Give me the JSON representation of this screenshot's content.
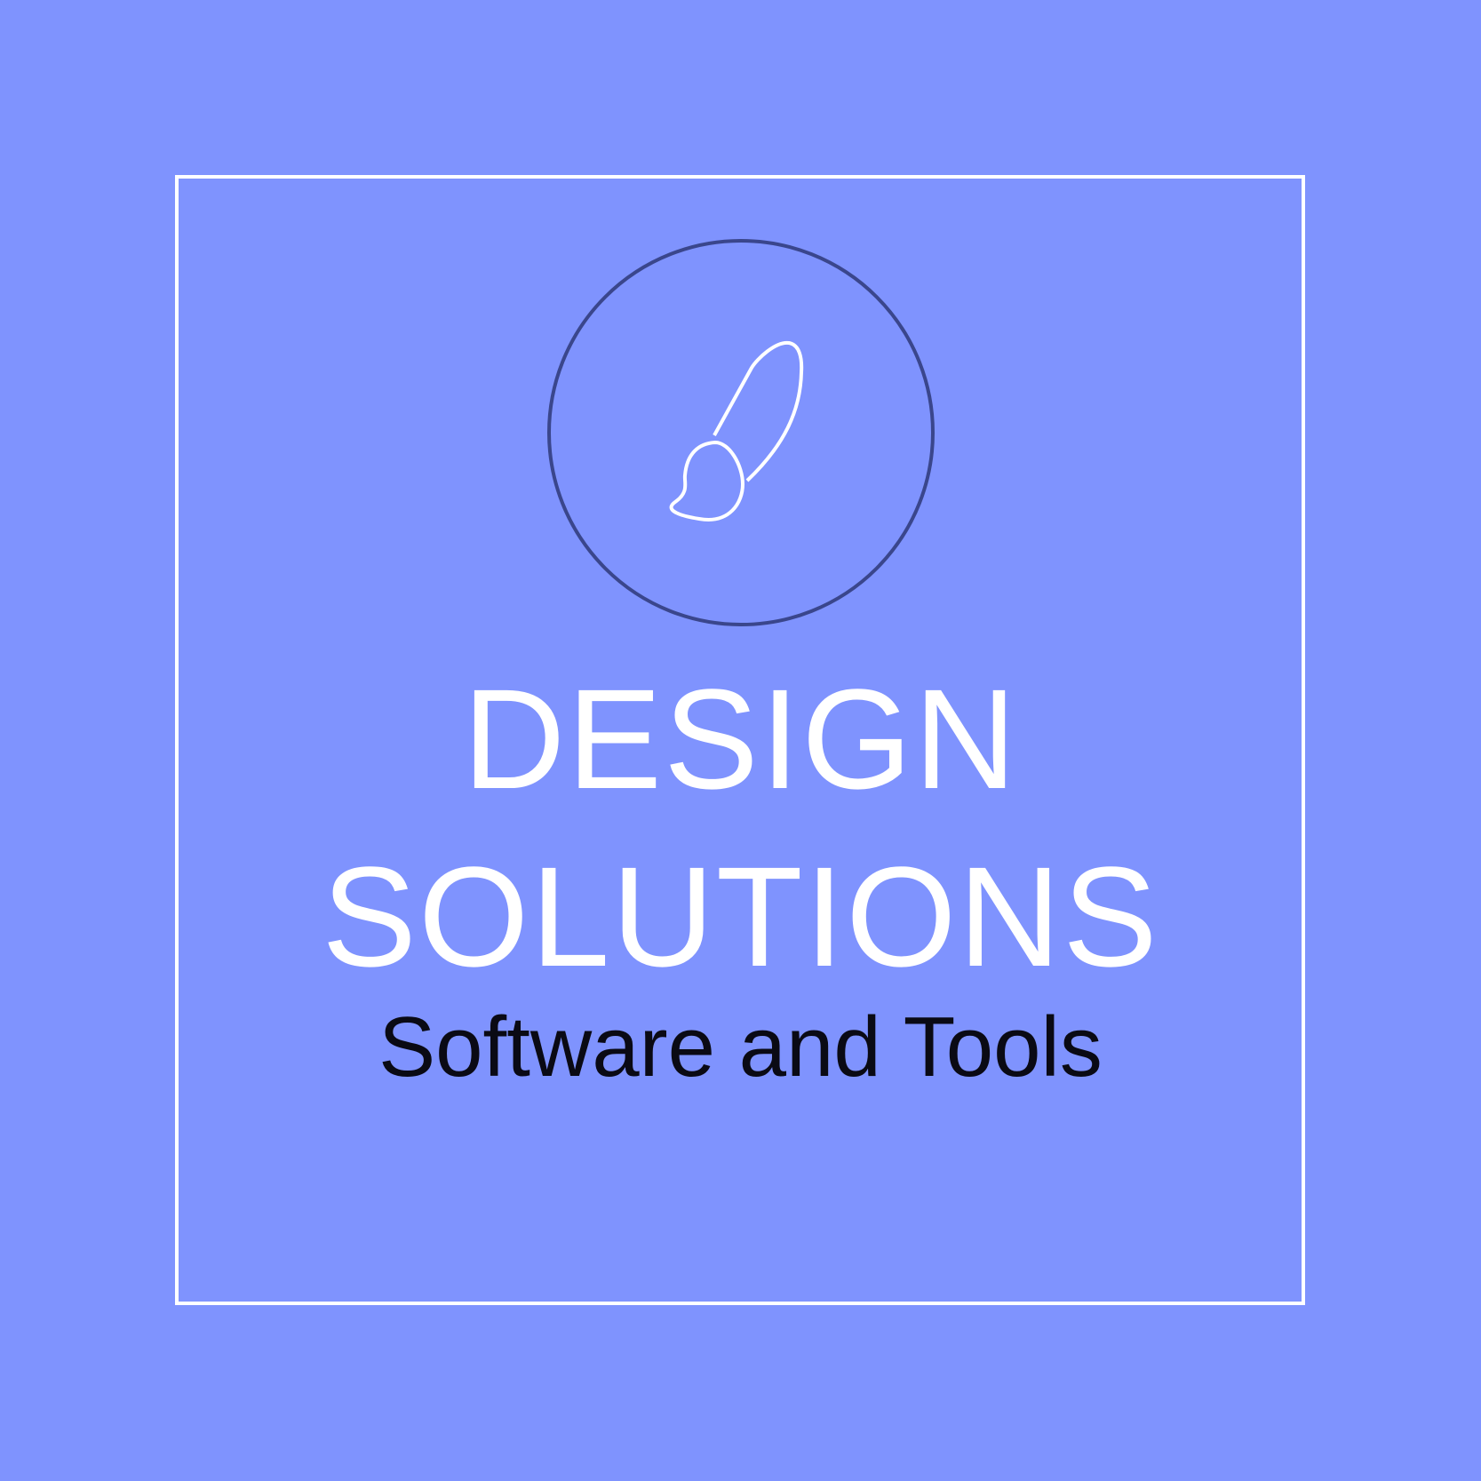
{
  "logo": {
    "title_line_1": "DESIGN",
    "title_line_2": "SOLUTIONS",
    "subtitle": "Software and Tools",
    "icon": "paintbrush-icon"
  },
  "colors": {
    "background": "#7f93fe",
    "frame": "#ffffff",
    "emblem_ring": "#3a468c",
    "title_text": "#ffffff",
    "subtitle_text": "#0a0a14"
  }
}
